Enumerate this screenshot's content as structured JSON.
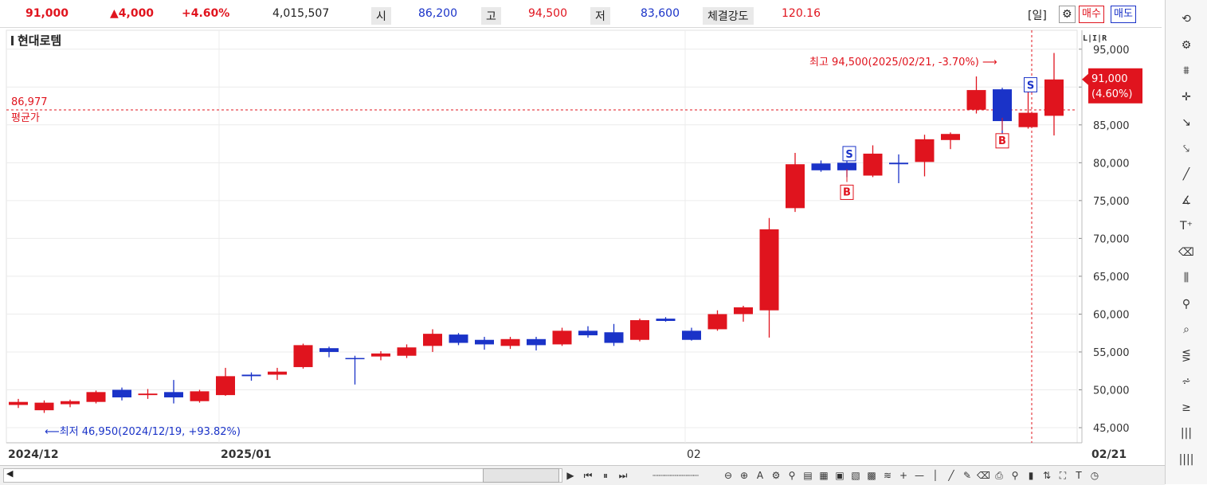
{
  "header": {
    "price": "91,000",
    "change": "▲4,000",
    "change_pct": "+4.60%",
    "volume": "4,015,507",
    "open_label": "시",
    "open": "86,200",
    "high_label": "고",
    "high": "94,500",
    "low_label": "저",
    "low": "83,600",
    "strength_label": "체결강도",
    "strength": "120.16",
    "period": "[일]",
    "buy_label": "매수",
    "sell_label": "매도"
  },
  "stock_name": "현대로템",
  "scale_buttons": "L|I|R",
  "colors": {
    "up": "#e0141e",
    "down": "#1a33c8",
    "avg_line": "#e0141e"
  },
  "chart_data": {
    "type": "candlestick",
    "y_range": [
      43000,
      97500
    ],
    "y_ticks": [
      45000,
      50000,
      55000,
      60000,
      65000,
      70000,
      75000,
      80000,
      85000,
      90000,
      95000
    ],
    "y_tick_labels": [
      "45,000",
      "50,000",
      "55,000",
      "60,000",
      "65,000",
      "70,000",
      "75,000",
      "80,000",
      "85,000",
      "90,000",
      "95,000"
    ],
    "x_labels": [
      {
        "index": 0,
        "text": "2024/12"
      },
      {
        "index": 8,
        "text": "2025/01"
      },
      {
        "index": 26,
        "text": "02"
      },
      {
        "index": 41,
        "text": "02/21"
      }
    ],
    "grid": true,
    "candles": [
      {
        "o": 48000,
        "h": 48800,
        "l": 47600,
        "c": 48400
      },
      {
        "o": 47300,
        "h": 48600,
        "l": 46950,
        "c": 48300
      },
      {
        "o": 48100,
        "h": 48700,
        "l": 47700,
        "c": 48500
      },
      {
        "o": 48400,
        "h": 49900,
        "l": 48200,
        "c": 49700
      },
      {
        "o": 50000,
        "h": 50300,
        "l": 48600,
        "c": 49000
      },
      {
        "o": 49300,
        "h": 50100,
        "l": 48800,
        "c": 49500
      },
      {
        "o": 49700,
        "h": 51300,
        "l": 48200,
        "c": 49000
      },
      {
        "o": 48500,
        "h": 50000,
        "l": 48300,
        "c": 49800
      },
      {
        "o": 49300,
        "h": 52900,
        "l": 49200,
        "c": 51800
      },
      {
        "o": 52000,
        "h": 52300,
        "l": 51200,
        "c": 51800
      },
      {
        "o": 52000,
        "h": 52900,
        "l": 51300,
        "c": 52400
      },
      {
        "o": 53000,
        "h": 56100,
        "l": 52800,
        "c": 55900
      },
      {
        "o": 55500,
        "h": 55700,
        "l": 54300,
        "c": 55000
      },
      {
        "o": 54200,
        "h": 54500,
        "l": 50700,
        "c": 54100
      },
      {
        "o": 54400,
        "h": 55100,
        "l": 53900,
        "c": 54800
      },
      {
        "o": 54500,
        "h": 56000,
        "l": 54200,
        "c": 55600
      },
      {
        "o": 55800,
        "h": 58000,
        "l": 55000,
        "c": 57400
      },
      {
        "o": 57300,
        "h": 57500,
        "l": 55900,
        "c": 56200
      },
      {
        "o": 56600,
        "h": 57000,
        "l": 55300,
        "c": 56000
      },
      {
        "o": 55800,
        "h": 57000,
        "l": 55400,
        "c": 56700
      },
      {
        "o": 56700,
        "h": 57000,
        "l": 55200,
        "c": 55900
      },
      {
        "o": 56000,
        "h": 58200,
        "l": 55800,
        "c": 57800
      },
      {
        "o": 57800,
        "h": 58400,
        "l": 56900,
        "c": 57200
      },
      {
        "o": 57600,
        "h": 58700,
        "l": 55800,
        "c": 56200
      },
      {
        "o": 56600,
        "h": 59400,
        "l": 56400,
        "c": 59200
      },
      {
        "o": 59400,
        "h": 59600,
        "l": 59000,
        "c": 59100
      },
      {
        "o": 57800,
        "h": 58200,
        "l": 56500,
        "c": 56600
      },
      {
        "o": 58000,
        "h": 60500,
        "l": 57800,
        "c": 60000
      },
      {
        "o": 60000,
        "h": 61100,
        "l": 59000,
        "c": 60900
      },
      {
        "o": 60500,
        "h": 72700,
        "l": 56900,
        "c": 71200
      },
      {
        "o": 74000,
        "h": 81300,
        "l": 73500,
        "c": 79800
      },
      {
        "o": 79900,
        "h": 80300,
        "l": 78800,
        "c": 79000
      },
      {
        "o": 80000,
        "h": 81600,
        "l": 78100,
        "c": 79000
      },
      {
        "o": 78300,
        "h": 82300,
        "l": 78100,
        "c": 81200
      },
      {
        "o": 80000,
        "h": 81100,
        "l": 77300,
        "c": 79800
      },
      {
        "o": 80100,
        "h": 83700,
        "l": 78200,
        "c": 83100
      },
      {
        "o": 83000,
        "h": 84000,
        "l": 81800,
        "c": 83800
      },
      {
        "o": 87000,
        "h": 91400,
        "l": 86500,
        "c": 89600
      },
      {
        "o": 89700,
        "h": 89900,
        "l": 83700,
        "c": 85500
      },
      {
        "o": 84700,
        "h": 90000,
        "l": 84500,
        "c": 86600
      },
      {
        "o": 86200,
        "h": 94500,
        "l": 83600,
        "c": 91000
      }
    ],
    "avg_line": {
      "value": 86977,
      "label_value": "86,977",
      "label": "평균가"
    },
    "last_price": {
      "label": "91,000",
      "pct": "(4.60%)"
    },
    "high_annotation": "최고 94,500(2025/02/21, -3.70%)",
    "low_annotation": "최저 46,950(2024/12/19, +93.82%)",
    "trade_markers": [
      {
        "index": 32,
        "type": "S",
        "price": 81200
      },
      {
        "index": 32,
        "type": "B",
        "price": 76200
      },
      {
        "index": 38,
        "type": "B",
        "price": 83000
      },
      {
        "index": 39,
        "type": "S",
        "price": 90300
      }
    ]
  },
  "toolbar_icons": [
    "refresh-icon",
    "settings-icon",
    "indicator-icon",
    "crosshair-icon",
    "trend-draw-icon",
    "ray-icon",
    "line-icon",
    "auto-icon",
    "text-icon",
    "all-erase-icon",
    "candle-icon",
    "zoom-in-icon",
    "zoom-fit-icon",
    "compare-icon",
    "pattern-icon",
    "fibonacci-icon",
    "vertical-lines-icon",
    "grid-lines-icon"
  ]
}
